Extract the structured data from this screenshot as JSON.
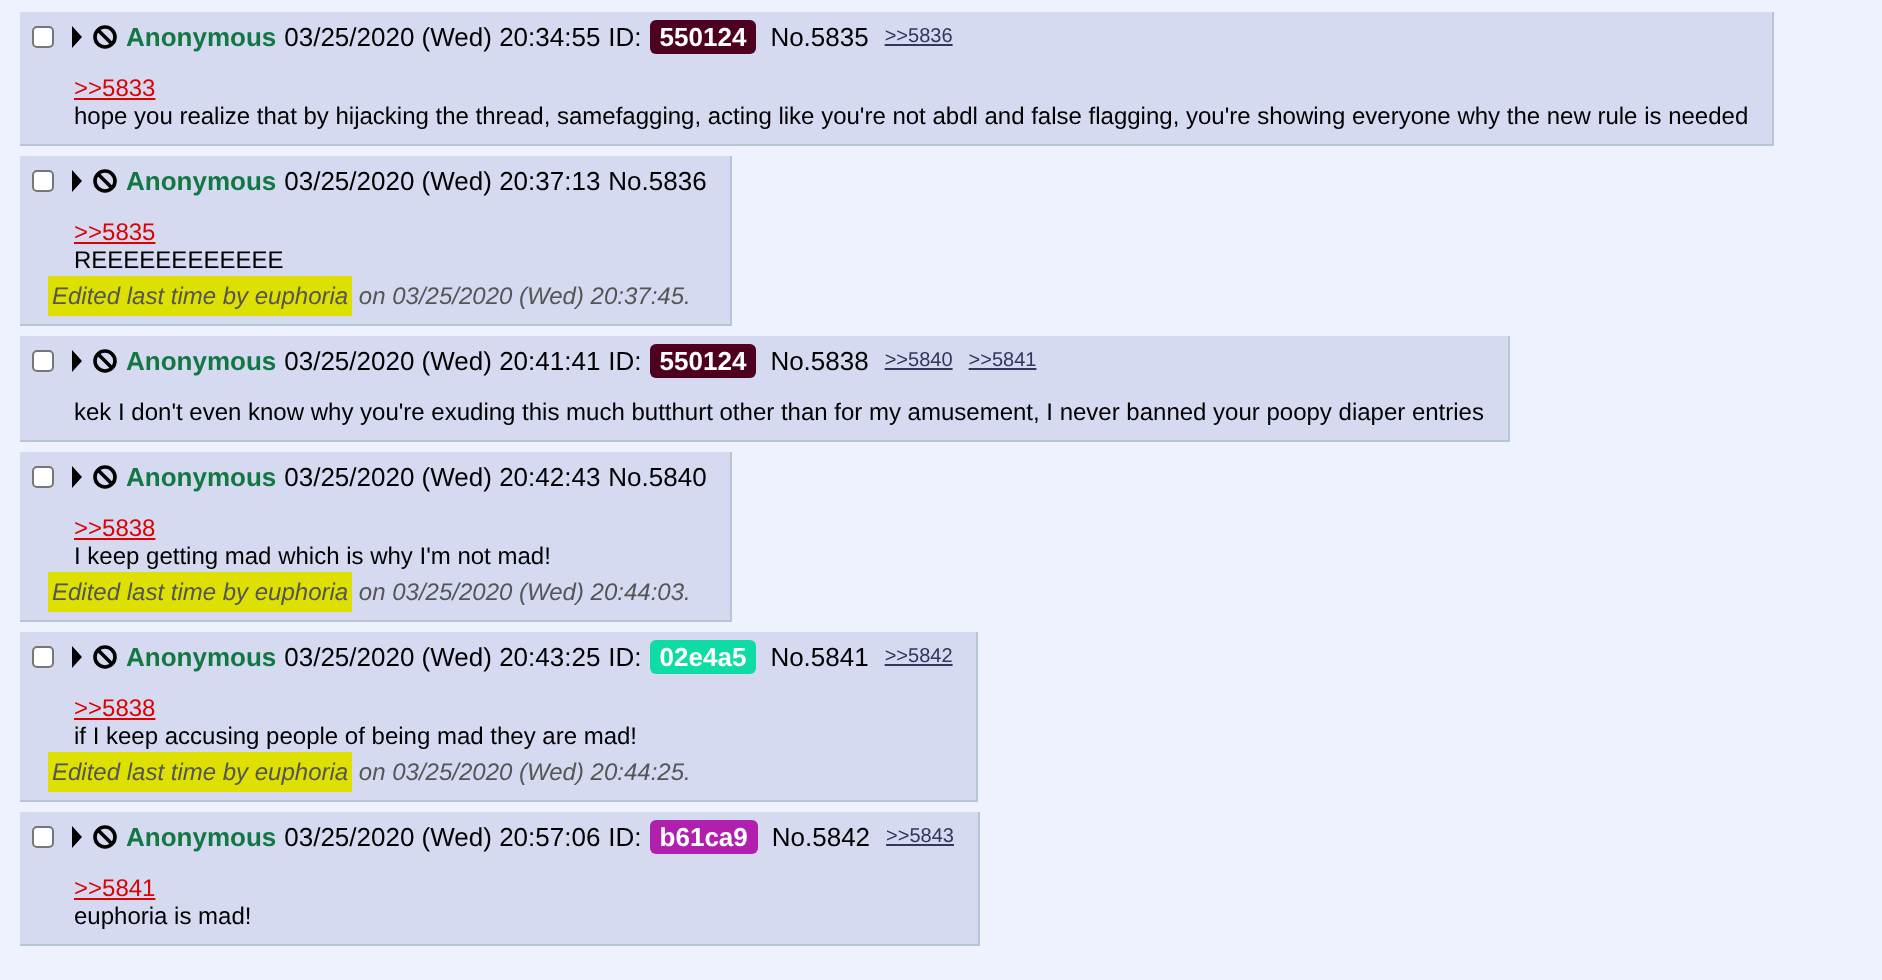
{
  "posts": [
    {
      "checked": false,
      "name": "Anonymous",
      "date": "03/25/2020 (Wed) 20:34:55",
      "id_label": "ID:",
      "id": "550124",
      "color": "#4d0020",
      "number": "No.5835",
      "backlinks": [
        ">>5836"
      ],
      "quote": ">>5833",
      "body": "hope you realize that by hijacking the thread, samefagging, acting like you're not abdl and false flagging, you're showing everyone why the new rule is needed"
    },
    {
      "checked": false,
      "name": "Anonymous",
      "date": "03/25/2020 (Wed) 20:37:13",
      "number": "No.5836",
      "quote": ">>5835",
      "body": "REEEEEEEEEEEE",
      "edit": {
        "lead": "Edited last time by euphoria",
        "rest": " on 03/25/2020 (Wed) 20:37:45.",
        "highlighted": true
      }
    },
    {
      "checked": false,
      "name": "Anonymous",
      "date": "03/25/2020 (Wed) 20:41:41",
      "id_label": "ID:",
      "id": "550124",
      "color": "#4d0020",
      "number": "No.5838",
      "backlinks": [
        ">>5840",
        ">>5841"
      ],
      "body": "kek I don't even know why you're exuding this much butthurt other than for my amusement, I never banned your poopy diaper entries"
    },
    {
      "checked": false,
      "name": "Anonymous",
      "date": "03/25/2020 (Wed) 20:42:43",
      "number": "No.5840",
      "quote": ">>5838",
      "body": "I keep getting mad which is why I'm not mad!",
      "edit": {
        "lead": "Edited last time by euphoria",
        "rest": " on 03/25/2020 (Wed) 20:44:03.",
        "highlighted": true
      }
    },
    {
      "checked": false,
      "name": "Anonymous",
      "date": "03/25/2020 (Wed) 20:43:25",
      "id_label": "ID:",
      "id": "02e4a5",
      "color": "#0fdca4",
      "number": "No.5841",
      "backlinks": [
        ">>5842"
      ],
      "quote": ">>5838",
      "body": "if I keep accusing people of being mad they are mad!",
      "edit": {
        "lead": "Edited last time by euphoria",
        "rest": " on 03/25/2020 (Wed) 20:44:25.",
        "highlighted": true
      }
    },
    {
      "checked": false,
      "name": "Anonymous",
      "date": "03/25/2020 (Wed) 20:57:06",
      "id_label": "ID:",
      "id": "b61ca9",
      "color": "#b01fae",
      "number": "No.5842",
      "backlinks": [
        ">>5843"
      ],
      "quote": ">>5841",
      "body": "euphoria is mad!"
    }
  ]
}
